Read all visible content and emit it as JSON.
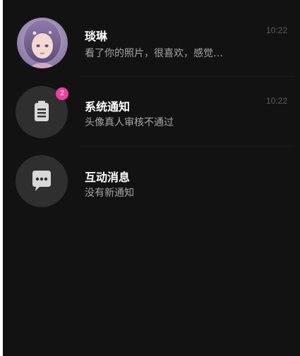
{
  "conversations": [
    {
      "name": "琰琳",
      "preview": "看了你的照片，很喜欢，感觉…",
      "time": "10:22",
      "avatar_icon": "girl-portrait-avatar"
    },
    {
      "name": "系统通知",
      "preview": "头像真人审核不通过",
      "time": "10:22",
      "badge": "2",
      "avatar_icon": "clipboard-icon"
    },
    {
      "name": "互动消息",
      "preview": "没有新通知",
      "avatar_icon": "chat-bubble-icon"
    }
  ],
  "colors": {
    "background": "#121212",
    "icon_circle": "#2f2f2f",
    "badge": "#ee3fa2",
    "name_text": "#ffffff",
    "preview_text": "#a6a6a6",
    "time_text": "#5d5d5d"
  }
}
